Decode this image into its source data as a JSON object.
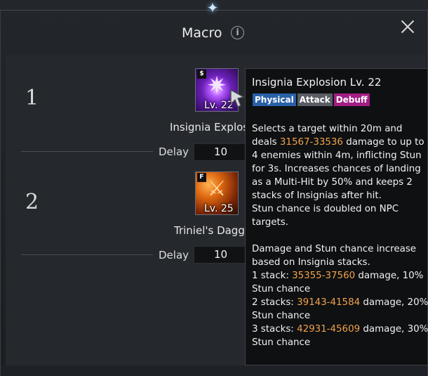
{
  "window": {
    "title": "Macro",
    "info_icon": "info-icon",
    "close_icon": "close-icon"
  },
  "slots": [
    {
      "number": "1",
      "icon_badge": "$",
      "icon_level": "Lv. 22",
      "skill_name": "Insignia Explos",
      "delay_label": "Delay",
      "delay_value": "10"
    },
    {
      "number": "2",
      "icon_badge": "F",
      "icon_level": "Lv. 25",
      "skill_name": "Triniel's Dagg",
      "delay_label": "Delay",
      "delay_value": "10"
    }
  ],
  "tooltip": {
    "title": "Insignia Explosion Lv. 22",
    "tags": [
      "Physical",
      "Attack",
      "Debuff"
    ],
    "desc": {
      "p1_a": "Selects a target within 20m and deals ",
      "p1_dmg": "31567-33536",
      "p1_b": " damage to up to 4 enemies within 4m, inflicting Stun for 3s. Increases chances of landing as a Multi-Hit by 50% and keeps 2 stacks of Insignias after hit.",
      "p2": "Stun chance is doubled on NPC targets.",
      "p3": "Damage and Stun chance increase based on Insignia stacks.",
      "s1_label": "1 stack: ",
      "s1_dmg": "35355-37560",
      "s1_rest": " damage, 10% Stun chance",
      "s2_label": "2 stacks: ",
      "s2_dmg": "39143-41584",
      "s2_rest": " damage, 20% Stun chance",
      "s3_label": "3 stacks: ",
      "s3_dmg": "42931-45609",
      "s3_rest": " damage, 30% Stun chance"
    }
  },
  "colors": {
    "damage_highlight": "#f0a24a",
    "physical": "#2860a8",
    "attack": "#5a5d63",
    "debuff": "#a21e84"
  }
}
